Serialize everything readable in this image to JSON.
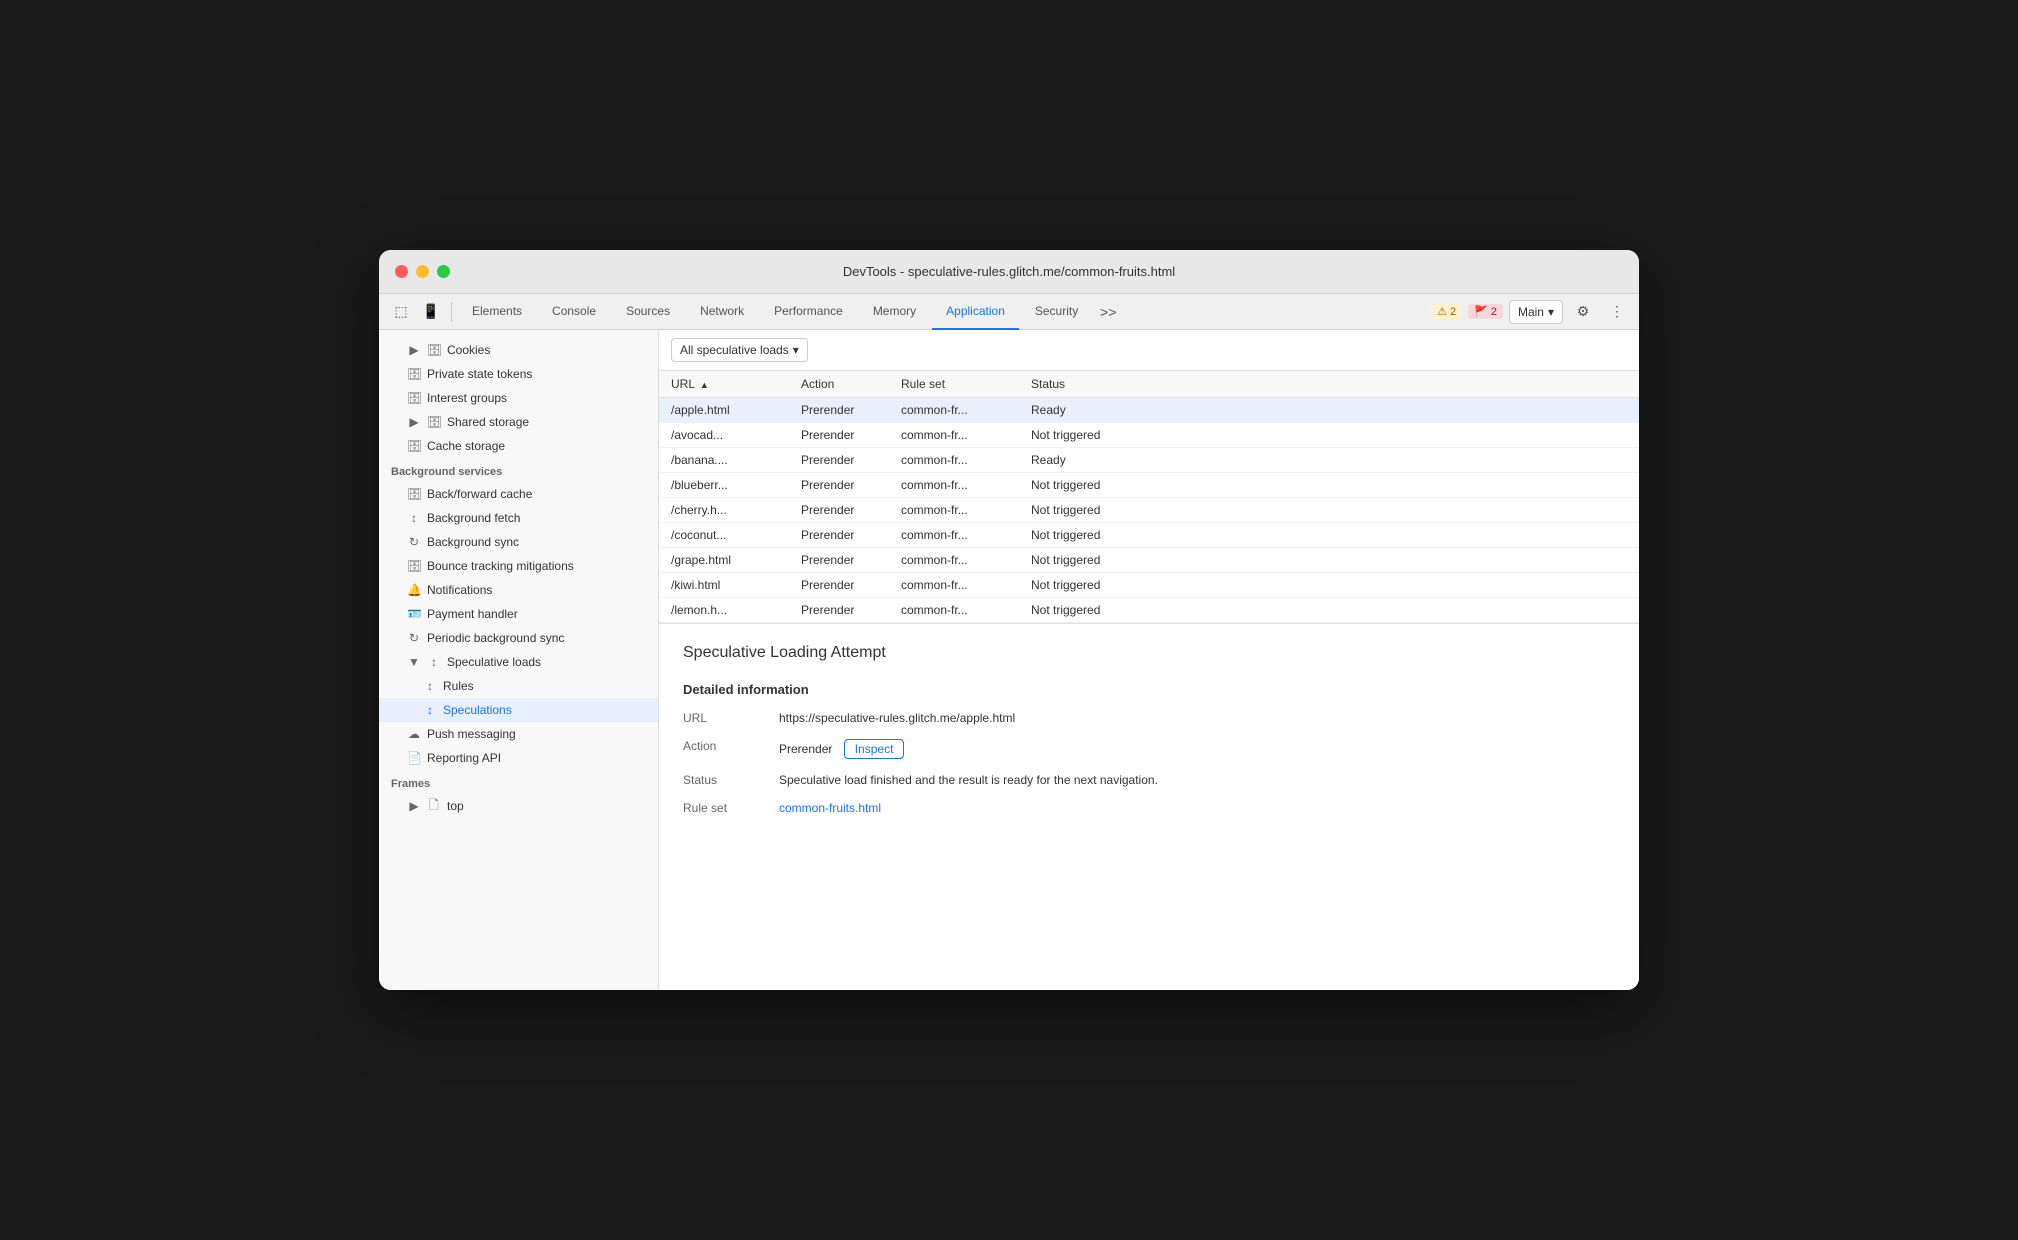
{
  "window": {
    "title": "DevTools - speculative-rules.glitch.me/common-fruits.html"
  },
  "toolbar": {
    "tabs": [
      {
        "id": "elements",
        "label": "Elements",
        "active": false
      },
      {
        "id": "console",
        "label": "Console",
        "active": false
      },
      {
        "id": "sources",
        "label": "Sources",
        "active": false
      },
      {
        "id": "network",
        "label": "Network",
        "active": false
      },
      {
        "id": "performance",
        "label": "Performance",
        "active": false
      },
      {
        "id": "memory",
        "label": "Memory",
        "active": false
      },
      {
        "id": "application",
        "label": "Application",
        "active": true
      },
      {
        "id": "security",
        "label": "Security",
        "active": false
      }
    ],
    "warn_count": "2",
    "err_count": "2",
    "main_label": "Main"
  },
  "sidebar": {
    "sections": [
      {
        "id": "storage",
        "items": [
          {
            "id": "cookies",
            "label": "Cookies",
            "icon": "▶ 🗄",
            "indent": 1
          },
          {
            "id": "private-state-tokens",
            "label": "Private state tokens",
            "icon": "🗄",
            "indent": 1
          },
          {
            "id": "interest-groups",
            "label": "Interest groups",
            "icon": "🗄",
            "indent": 1
          },
          {
            "id": "shared-storage",
            "label": "Shared storage",
            "icon": "▶ 🗄",
            "indent": 1
          },
          {
            "id": "cache-storage",
            "label": "Cache storage",
            "icon": "🗄",
            "indent": 1
          }
        ]
      },
      {
        "id": "background-services",
        "header": "Background services",
        "items": [
          {
            "id": "back-forward-cache",
            "label": "Back/forward cache",
            "icon": "🗄",
            "indent": 1
          },
          {
            "id": "background-fetch",
            "label": "Background fetch",
            "icon": "↕",
            "indent": 1
          },
          {
            "id": "background-sync",
            "label": "Background sync",
            "icon": "↻",
            "indent": 1
          },
          {
            "id": "bounce-tracking",
            "label": "Bounce tracking mitigations",
            "icon": "🗄",
            "indent": 1
          },
          {
            "id": "notifications",
            "label": "Notifications",
            "icon": "🔔",
            "indent": 1
          },
          {
            "id": "payment-handler",
            "label": "Payment handler",
            "icon": "🪪",
            "indent": 1
          },
          {
            "id": "periodic-bg-sync",
            "label": "Periodic background sync",
            "icon": "↻",
            "indent": 1
          },
          {
            "id": "speculative-loads",
            "label": "Speculative loads",
            "icon": "▼ ↕",
            "indent": 1,
            "expanded": true
          },
          {
            "id": "rules",
            "label": "Rules",
            "icon": "↕",
            "indent": 2
          },
          {
            "id": "speculations",
            "label": "Speculations",
            "icon": "↕",
            "indent": 2,
            "active": true
          },
          {
            "id": "push-messaging",
            "label": "Push messaging",
            "icon": "☁",
            "indent": 1
          },
          {
            "id": "reporting-api",
            "label": "Reporting API",
            "icon": "📄",
            "indent": 1
          }
        ]
      },
      {
        "id": "frames",
        "header": "Frames",
        "items": [
          {
            "id": "top",
            "label": "top",
            "icon": "▶ 🗋",
            "indent": 1
          }
        ]
      }
    ]
  },
  "content": {
    "filter_label": "All speculative loads",
    "table": {
      "columns": [
        "URL",
        "Action",
        "Rule set",
        "Status"
      ],
      "rows": [
        {
          "url": "/apple.html",
          "action": "Prerender",
          "ruleset": "common-fr...",
          "status": "Ready",
          "selected": true
        },
        {
          "url": "/avocad...",
          "action": "Prerender",
          "ruleset": "common-fr...",
          "status": "Not triggered",
          "selected": false
        },
        {
          "url": "/banana....",
          "action": "Prerender",
          "ruleset": "common-fr...",
          "status": "Ready",
          "selected": false
        },
        {
          "url": "/blueberr...",
          "action": "Prerender",
          "ruleset": "common-fr...",
          "status": "Not triggered",
          "selected": false
        },
        {
          "url": "/cherry.h...",
          "action": "Prerender",
          "ruleset": "common-fr...",
          "status": "Not triggered",
          "selected": false
        },
        {
          "url": "/coconut...",
          "action": "Prerender",
          "ruleset": "common-fr...",
          "status": "Not triggered",
          "selected": false
        },
        {
          "url": "/grape.html",
          "action": "Prerender",
          "ruleset": "common-fr...",
          "status": "Not triggered",
          "selected": false
        },
        {
          "url": "/kiwi.html",
          "action": "Prerender",
          "ruleset": "common-fr...",
          "status": "Not triggered",
          "selected": false
        },
        {
          "url": "/lemon.h...",
          "action": "Prerender",
          "ruleset": "common-fr...",
          "status": "Not triggered",
          "selected": false
        }
      ]
    },
    "detail": {
      "title": "Speculative Loading Attempt",
      "section_title": "Detailed information",
      "url_label": "URL",
      "url_value": "https://speculative-rules.glitch.me/apple.html",
      "action_label": "Action",
      "action_value": "Prerender",
      "inspect_label": "Inspect",
      "status_label": "Status",
      "status_value": "Speculative load finished and the result is ready for the next navigation.",
      "ruleset_label": "Rule set",
      "ruleset_value": "common-fruits.html"
    }
  },
  "colors": {
    "active_tab": "#1a73e8",
    "selected_row_bg": "#e8f0fe",
    "link_color": "#1a73e8"
  }
}
